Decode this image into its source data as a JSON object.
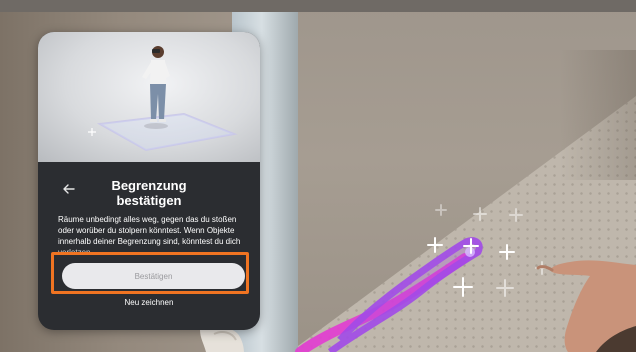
{
  "dialog": {
    "title_line1": "Begrenzung",
    "title_line2": "bestätigen",
    "body": "Räume unbedingt alles weg, gegen das du stoßen oder worüber du stolpern könntest. Wenn Objekte innerhalb deiner Begrenzung sind, könntest du dich verletzen.",
    "confirm_button": "Bestätigen",
    "redraw_link": "Neu zeichnen",
    "back_icon": "arrow-left-icon",
    "highlight_color": "#f07422"
  },
  "scene": {
    "boundary_colors": [
      "#e23bd2",
      "#a24be8"
    ],
    "marker_icon": "plus-marker-icon"
  }
}
